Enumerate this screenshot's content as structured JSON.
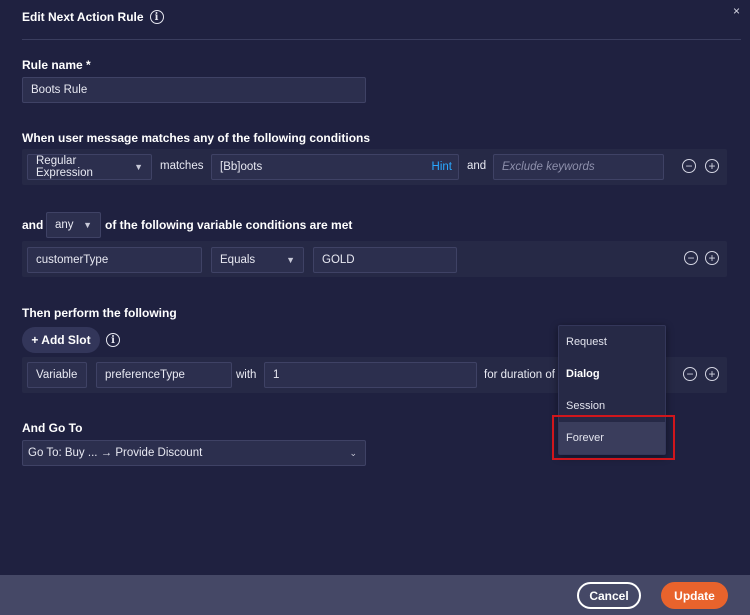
{
  "dialog": {
    "title": "Edit Next Action Rule",
    "close_symbol": "×"
  },
  "rule_name": {
    "label": "Rule name *",
    "value": "Boots Rule"
  },
  "message_conditions": {
    "label": "When user message matches any of the following conditions",
    "match_type": "Regular Expression",
    "matches_text": "matches",
    "pattern": "[Bb]oots",
    "hint": "Hint",
    "and_text": "and",
    "exclude_placeholder": "Exclude keywords"
  },
  "variable_conditions": {
    "prefix": "and",
    "quantifier": "any",
    "suffix": "of the following variable conditions are met",
    "variable": "customerType",
    "operator": "Equals",
    "value": "GOLD"
  },
  "actions": {
    "label": "Then perform the following",
    "add_slot_label": "+ Add Slot",
    "slot_type": "Variable",
    "slot_name": "preferenceType",
    "with_text": "with",
    "slot_value": "1",
    "duration_text": "for duration of"
  },
  "duration_dropdown": {
    "options": [
      "Request",
      "Dialog",
      "Session",
      "Forever"
    ],
    "selected": "Dialog",
    "hovered": "Forever"
  },
  "go_to": {
    "label": "And Go To",
    "value": "Go To: Buy ... → Provide Discount"
  },
  "footer": {
    "cancel_label": "Cancel",
    "update_label": "Update"
  },
  "colors": {
    "background": "#1f2140",
    "accent_link": "#29a8ff",
    "primary_button": "#e8632c",
    "highlight": "#d0161c"
  }
}
